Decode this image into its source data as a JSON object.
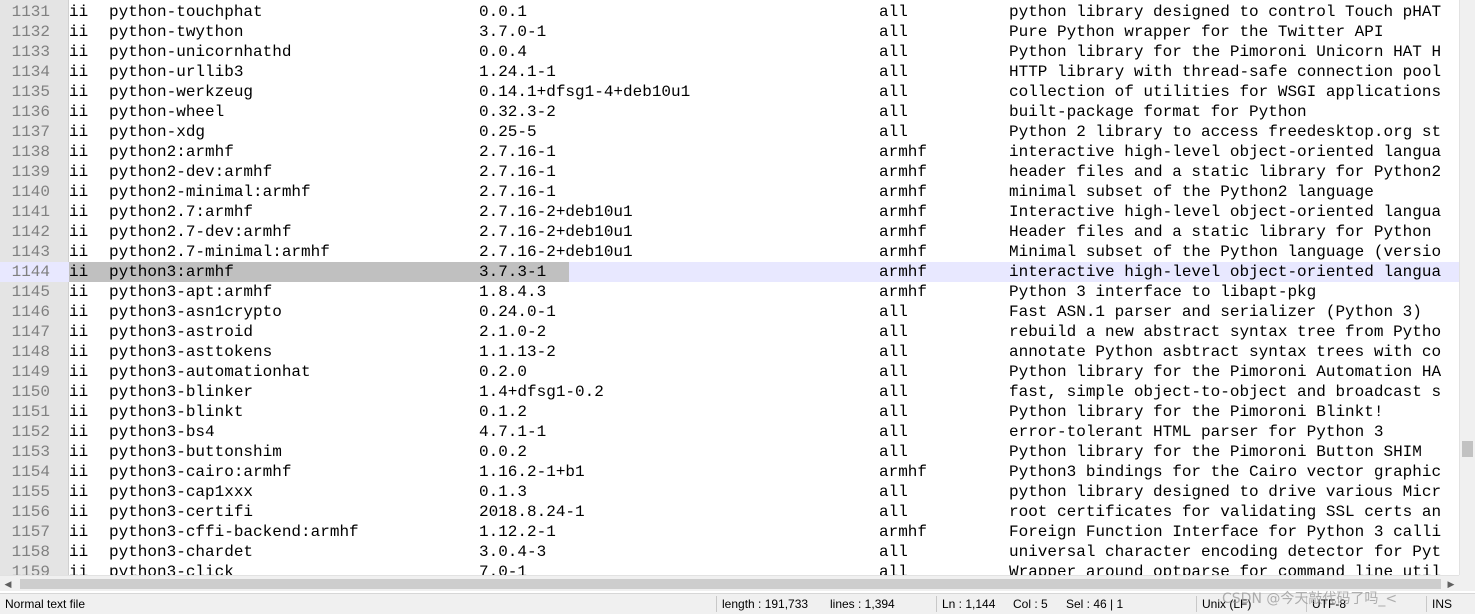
{
  "editor": {
    "current_line": "1144",
    "lines": [
      {
        "ln": "1131",
        "flag": "ii",
        "name": "python-touchphat",
        "version": "0.0.1",
        "arch": "all",
        "desc": "python library designed to control Touch pHAT"
      },
      {
        "ln": "1132",
        "flag": "ii",
        "name": "python-twython",
        "version": "3.7.0-1",
        "arch": "all",
        "desc": "Pure Python wrapper for the Twitter API"
      },
      {
        "ln": "1133",
        "flag": "ii",
        "name": "python-unicornhathd",
        "version": "0.0.4",
        "arch": "all",
        "desc": "Python library for the Pimoroni Unicorn HAT H"
      },
      {
        "ln": "1134",
        "flag": "ii",
        "name": "python-urllib3",
        "version": "1.24.1-1",
        "arch": "all",
        "desc": "HTTP library with thread-safe connection pool"
      },
      {
        "ln": "1135",
        "flag": "ii",
        "name": "python-werkzeug",
        "version": "0.14.1+dfsg1-4+deb10u1",
        "arch": "all",
        "desc": "collection of utilities for WSGI applications"
      },
      {
        "ln": "1136",
        "flag": "ii",
        "name": "python-wheel",
        "version": "0.32.3-2",
        "arch": "all",
        "desc": "built-package format for Python"
      },
      {
        "ln": "1137",
        "flag": "ii",
        "name": "python-xdg",
        "version": "0.25-5",
        "arch": "all",
        "desc": "Python 2 library to access freedesktop.org st"
      },
      {
        "ln": "1138",
        "flag": "ii",
        "name": "python2:armhf",
        "version": "2.7.16-1",
        "arch": "armhf",
        "desc": "interactive high-level object-oriented langua"
      },
      {
        "ln": "1139",
        "flag": "ii",
        "name": "python2-dev:armhf",
        "version": "2.7.16-1",
        "arch": "armhf",
        "desc": "header files and a static library for Python2"
      },
      {
        "ln": "1140",
        "flag": "ii",
        "name": "python2-minimal:armhf",
        "version": "2.7.16-1",
        "arch": "armhf",
        "desc": "minimal subset of the Python2 language"
      },
      {
        "ln": "1141",
        "flag": "ii",
        "name": "python2.7:armhf",
        "version": "2.7.16-2+deb10u1",
        "arch": "armhf",
        "desc": "Interactive high-level object-oriented langua"
      },
      {
        "ln": "1142",
        "flag": "ii",
        "name": "python2.7-dev:armhf",
        "version": "2.7.16-2+deb10u1",
        "arch": "armhf",
        "desc": "Header files and a static library for Python"
      },
      {
        "ln": "1143",
        "flag": "ii",
        "name": "python2.7-minimal:armhf",
        "version": "2.7.16-2+deb10u1",
        "arch": "armhf",
        "desc": "Minimal subset of the Python language (versio"
      },
      {
        "ln": "1144",
        "flag": "ii",
        "name": "python3:armhf",
        "version": "3.7.3-1",
        "arch": "armhf",
        "desc": "interactive high-level object-oriented langua"
      },
      {
        "ln": "1145",
        "flag": "ii",
        "name": "python3-apt:armhf",
        "version": "1.8.4.3",
        "arch": "armhf",
        "desc": "Python 3 interface to libapt-pkg"
      },
      {
        "ln": "1146",
        "flag": "ii",
        "name": "python3-asn1crypto",
        "version": "0.24.0-1",
        "arch": "all",
        "desc": "Fast ASN.1 parser and serializer (Python 3)"
      },
      {
        "ln": "1147",
        "flag": "ii",
        "name": "python3-astroid",
        "version": "2.1.0-2",
        "arch": "all",
        "desc": "rebuild a new abstract syntax tree from Pytho"
      },
      {
        "ln": "1148",
        "flag": "ii",
        "name": "python3-asttokens",
        "version": "1.1.13-2",
        "arch": "all",
        "desc": "annotate Python asbtract syntax trees with co"
      },
      {
        "ln": "1149",
        "flag": "ii",
        "name": "python3-automationhat",
        "version": "0.2.0",
        "arch": "all",
        "desc": "Python library for the Pimoroni Automation HA"
      },
      {
        "ln": "1150",
        "flag": "ii",
        "name": "python3-blinker",
        "version": "1.4+dfsg1-0.2",
        "arch": "all",
        "desc": "fast, simple object-to-object and broadcast s"
      },
      {
        "ln": "1151",
        "flag": "ii",
        "name": "python3-blinkt",
        "version": "0.1.2",
        "arch": "all",
        "desc": "Python library for the Pimoroni Blinkt!"
      },
      {
        "ln": "1152",
        "flag": "ii",
        "name": "python3-bs4",
        "version": "4.7.1-1",
        "arch": "all",
        "desc": "error-tolerant HTML parser for Python 3"
      },
      {
        "ln": "1153",
        "flag": "ii",
        "name": "python3-buttonshim",
        "version": "0.0.2",
        "arch": "all",
        "desc": "Python library for the Pimoroni Button SHIM"
      },
      {
        "ln": "1154",
        "flag": "ii",
        "name": "python3-cairo:armhf",
        "version": "1.16.2-1+b1",
        "arch": "armhf",
        "desc": "Python3 bindings for the Cairo vector graphic"
      },
      {
        "ln": "1155",
        "flag": "ii",
        "name": "python3-cap1xxx",
        "version": "0.1.3",
        "arch": "all",
        "desc": "python library designed to drive various Micr"
      },
      {
        "ln": "1156",
        "flag": "ii",
        "name": "python3-certifi",
        "version": "2018.8.24-1",
        "arch": "all",
        "desc": "root certificates for validating SSL certs an"
      },
      {
        "ln": "1157",
        "flag": "ii",
        "name": "python3-cffi-backend:armhf",
        "version": "1.12.2-1",
        "arch": "armhf",
        "desc": "Foreign Function Interface for Python 3 calli"
      },
      {
        "ln": "1158",
        "flag": "ii",
        "name": "python3-chardet",
        "version": "3.0.4-3",
        "arch": "all",
        "desc": "universal character encoding detector for Pyt"
      },
      {
        "ln": "1159",
        "flag": "ii",
        "name": "python3-click",
        "version": "7.0-1",
        "arch": "all",
        "desc": "Wrapper around optparse for command line util"
      }
    ]
  },
  "statusbar": {
    "file_type": "Normal text file",
    "length": "length : 191,733",
    "lines": "lines : 1,394",
    "ln": "Ln : 1,144",
    "col": "Col : 5",
    "sel": "Sel : 46 | 1",
    "eol": "Unix (LF)",
    "encoding": "UTF-8",
    "mode": "INS"
  },
  "watermark": "CSDN @今天敲代码了吗_<"
}
